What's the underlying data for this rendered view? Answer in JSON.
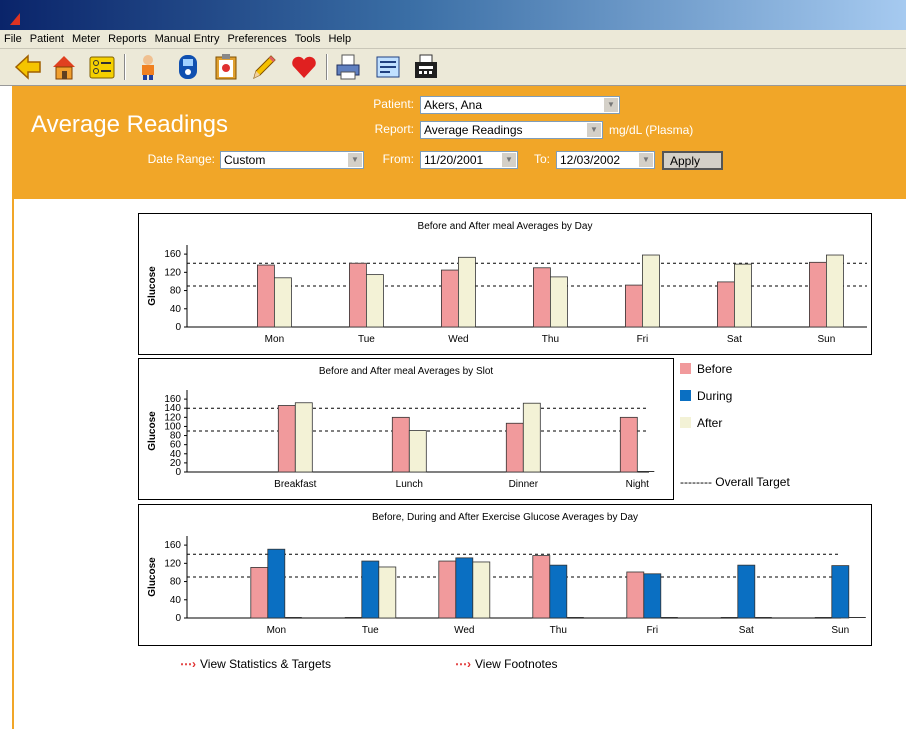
{
  "menu": [
    "File",
    "Patient",
    "Meter",
    "Reports",
    "Manual Entry",
    "Preferences",
    "Tools",
    "Help"
  ],
  "toolbar_icons": [
    "back-arrow-icon",
    "home-icon",
    "list-icon",
    "person-icon",
    "meter-icon",
    "clipboard-icon",
    "pencil-icon",
    "heart-icon",
    "printer-icon",
    "notepad-icon",
    "fax-icon"
  ],
  "header": {
    "title": "Average Readings",
    "patient_label": "Patient:",
    "patient_value": "Akers, Ana",
    "report_label": "Report:",
    "report_value": "Average Readings",
    "units": "mg/dL (Plasma)",
    "date_range_label": "Date Range:",
    "date_range_value": "Custom",
    "from_label": "From:",
    "from_value": "11/20/2001",
    "to_label": "To:",
    "to_value": "12/03/2002",
    "apply_label": "Apply"
  },
  "colors": {
    "before": "#f19a9c",
    "during": "#0a6fc2",
    "after": "#f3f2d6",
    "header": "#f1a628"
  },
  "legend": {
    "before": "Before",
    "during": "During",
    "after": "After",
    "target": "-------- Overall Target"
  },
  "links": {
    "stats": "View Statistics & Targets",
    "footnotes": "View Footnotes"
  },
  "chart_data": [
    {
      "type": "bar",
      "title": "Before and After meal Averages by Day",
      "ylabel": "Glucose",
      "ylim": [
        0,
        180
      ],
      "yticks": [
        0,
        40,
        80,
        120,
        160
      ],
      "target_lines": [
        90,
        140
      ],
      "categories": [
        "Mon",
        "Tue",
        "Wed",
        "Thu",
        "Fri",
        "Sat",
        "Sun"
      ],
      "series": [
        {
          "name": "Before",
          "values": [
            136,
            140,
            125,
            130,
            92,
            99,
            142
          ]
        },
        {
          "name": "After",
          "values": [
            108,
            115,
            153,
            110,
            158,
            138,
            158
          ]
        }
      ]
    },
    {
      "type": "bar",
      "title": "Before and After meal Averages by Slot",
      "ylabel": "Glucose",
      "ylim": [
        0,
        180
      ],
      "yticks": [
        0,
        20,
        40,
        60,
        80,
        100,
        120,
        140,
        160
      ],
      "target_lines": [
        90,
        140
      ],
      "categories": [
        "Breakfast",
        "Lunch",
        "Dinner",
        "Night"
      ],
      "series": [
        {
          "name": "Before",
          "values": [
            146,
            120,
            107,
            120
          ]
        },
        {
          "name": "After",
          "values": [
            152,
            91,
            151,
            0
          ]
        }
      ]
    },
    {
      "type": "bar",
      "title": "Before, During and After Exercise Glucose Averages by Day",
      "ylabel": "Glucose",
      "ylim": [
        0,
        180
      ],
      "yticks": [
        0,
        40,
        80,
        120,
        160
      ],
      "target_lines": [
        90,
        140
      ],
      "categories": [
        "Mon",
        "Tue",
        "Wed",
        "Thu",
        "Fri",
        "Sat",
        "Sun"
      ],
      "series": [
        {
          "name": "Before",
          "values": [
            111,
            0,
            125,
            137,
            101,
            0,
            0
          ]
        },
        {
          "name": "During",
          "values": [
            151,
            125,
            132,
            116,
            97,
            116,
            115
          ]
        },
        {
          "name": "After",
          "values": [
            0,
            112,
            123,
            0,
            0,
            0,
            0
          ]
        }
      ]
    }
  ]
}
